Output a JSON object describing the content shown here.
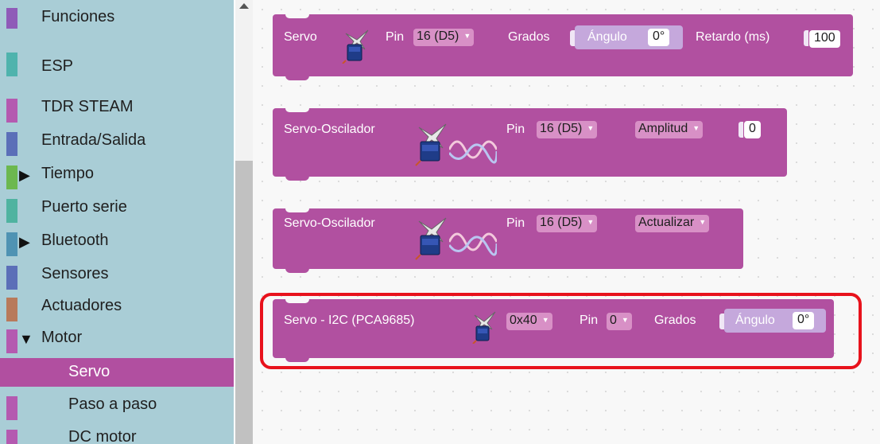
{
  "sidebar": {
    "items": [
      {
        "label": "Funciones",
        "color": "#8f5bb8"
      },
      {
        "label": "ESP",
        "color": "#4fb3ad"
      },
      {
        "label": "TDR STEAM",
        "color": "#b45ab0"
      },
      {
        "label": "Entrada/Salida",
        "color": "#5b6fb8"
      },
      {
        "label": "Tiempo",
        "color": "#6cb84f",
        "expander": "▶"
      },
      {
        "label": "Puerto serie",
        "color": "#4fb3a0"
      },
      {
        "label": "Bluetooth",
        "color": "#4f93b3",
        "expander": "▶"
      },
      {
        "label": "Sensores",
        "color": "#5b6fb8"
      },
      {
        "label": "Actuadores",
        "color": "#b87a5b"
      },
      {
        "label": "Motor",
        "color": "#b45ab0",
        "expander": "▼"
      },
      {
        "label": "Servo",
        "color": "#b150a0",
        "selected": true
      },
      {
        "label": "Paso a paso",
        "color": "#b45ab0"
      },
      {
        "label": "DC motor",
        "color": "#b45ab0"
      }
    ]
  },
  "blocks": {
    "servo": {
      "title": "Servo",
      "pin_label": "Pin",
      "pin_value": "16 (D5)",
      "grados_label": "Grados",
      "angulo_label": "Ángulo",
      "angulo_value": "0°",
      "retardo_label": "Retardo (ms)",
      "retardo_value": "100"
    },
    "oscilador1": {
      "title": "Servo-Oscilador",
      "pin_label": "Pin",
      "pin_value": "16 (D5)",
      "mode_value": "Amplitud",
      "num_value": "0"
    },
    "oscilador2": {
      "title": "Servo-Oscilador",
      "pin_label": "Pin",
      "pin_value": "16 (D5)",
      "mode_value": "Actualizar"
    },
    "i2c": {
      "title": "Servo - I2C (PCA9685)",
      "addr_value": "0x40",
      "pin_label": "Pin",
      "pin_value": "0",
      "grados_label": "Grados",
      "angulo_label": "Ángulo",
      "angulo_value": "0°"
    }
  },
  "colors": {
    "block": "#b150a0",
    "sidebar": "#a9cdd6",
    "highlight": "#e8121c"
  }
}
